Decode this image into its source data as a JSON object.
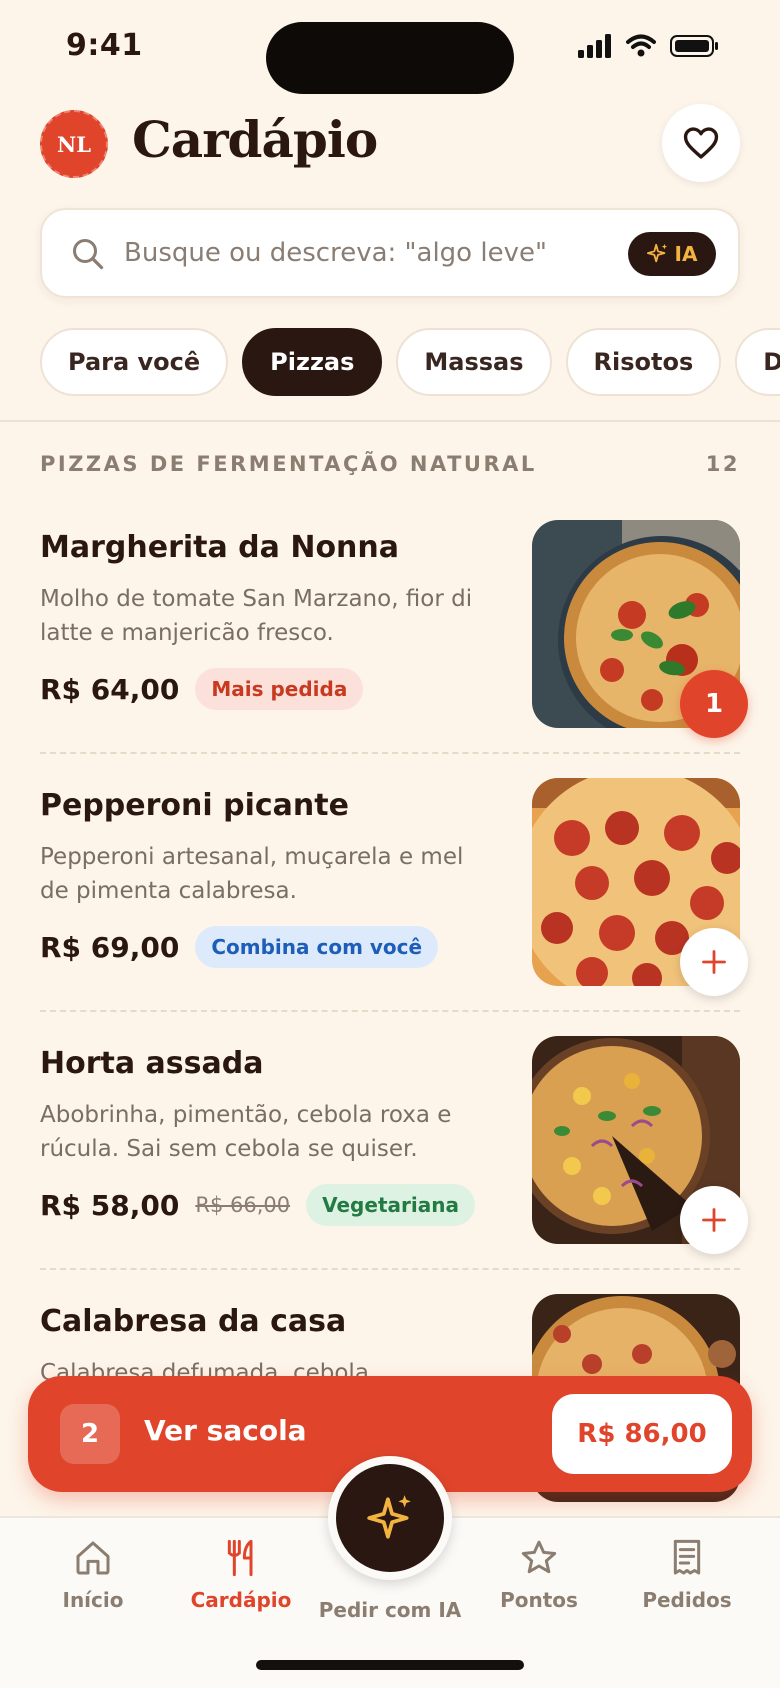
{
  "status": {
    "time": "9:41"
  },
  "header": {
    "logo_text": "NL",
    "title": "Cardápio",
    "favorite_icon": "heart-icon"
  },
  "search": {
    "placeholder": "Busque ou descreva: \"algo leve\"",
    "ai_label": "IA"
  },
  "categories": [
    {
      "label": "Para você",
      "active": false
    },
    {
      "label": "Pizzas",
      "active": true
    },
    {
      "label": "Massas",
      "active": false
    },
    {
      "label": "Risotos",
      "active": false
    },
    {
      "label": "Doces",
      "active": false
    }
  ],
  "section": {
    "title": "PIZZAS DE FERMENTAÇÃO NATURAL",
    "count": "12"
  },
  "items": [
    {
      "name": "Margherita da Nonna",
      "description": "Molho de tomate San Marzano, fior di latte e manjericão fresco.",
      "price": "R$ 64,00",
      "badge": "Mais pedida",
      "quantity": "1"
    },
    {
      "name": "Pepperoni picante",
      "description": "Pepperoni artesanal, muçarela e mel de pimenta calabresa.",
      "price": "R$ 69,00",
      "badge": "Combina com você"
    },
    {
      "name": "Horta assada",
      "description": "Abobrinha, pimentão, cebola roxa e rúcula. Sai sem cebola se quiser.",
      "price": "R$ 58,00",
      "old_price": "R$ 66,00",
      "badge": "Vegetariana"
    },
    {
      "name": "Calabresa da casa",
      "description": "Calabresa defumada, cebola"
    }
  ],
  "bag": {
    "count": "2",
    "label": "Ver sacola",
    "total": "R$ 86,00"
  },
  "tabs": {
    "home": "Início",
    "menu": "Cardápio",
    "ai": "Pedir com IA",
    "points": "Pontos",
    "orders": "Pedidos"
  },
  "colors": {
    "accent": "#E0452C",
    "dark": "#2A1712",
    "background": "#FDF5EA",
    "ai_gold": "#F3B43F"
  }
}
